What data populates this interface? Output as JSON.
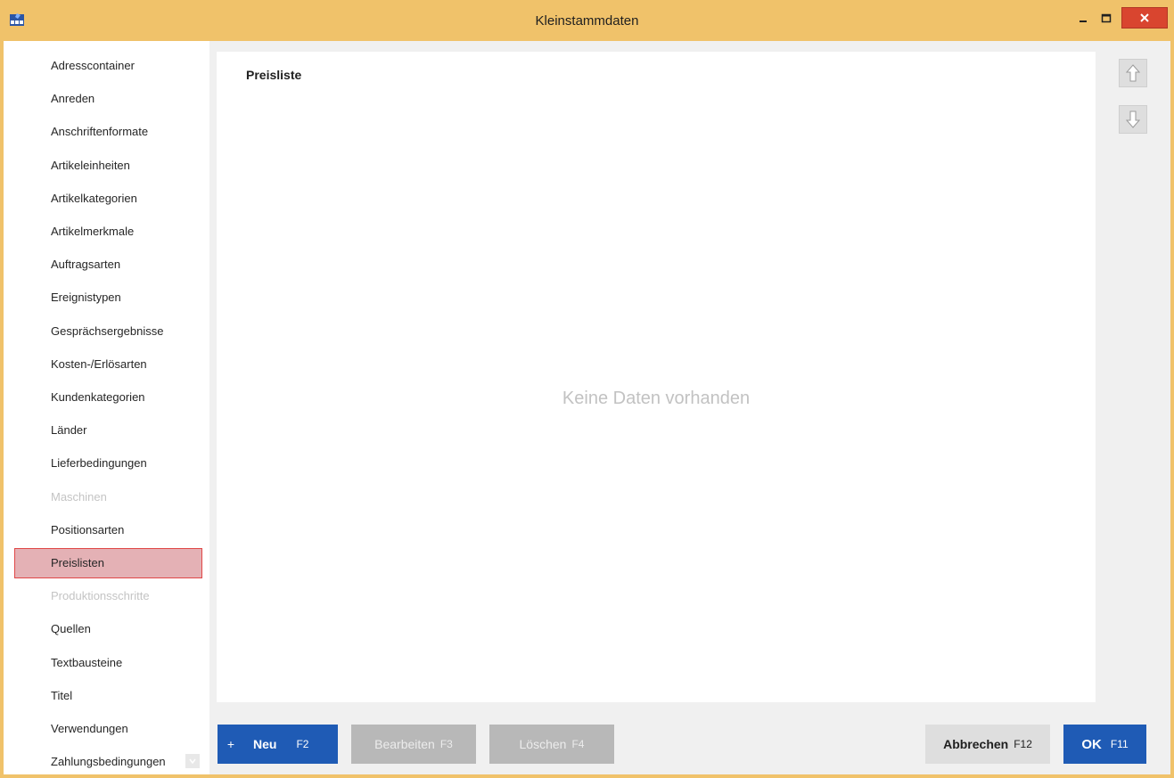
{
  "window": {
    "title": "Kleinstammdaten",
    "accent_color": "#f0c26a",
    "close_color": "#d9452f"
  },
  "icons": {
    "app": "app-icon",
    "minimize": "minimize-icon",
    "maximize": "maximize-icon",
    "close": "close-icon",
    "up": "arrow-up-icon",
    "down": "arrow-down-icon",
    "scroll": "chevron-down-icon"
  },
  "sidebar": {
    "items": [
      {
        "label": "Adresscontainer",
        "state": "normal"
      },
      {
        "label": "Anreden",
        "state": "normal"
      },
      {
        "label": "Anschriftenformate",
        "state": "normal"
      },
      {
        "label": "Artikeleinheiten",
        "state": "normal"
      },
      {
        "label": "Artikelkategorien",
        "state": "normal"
      },
      {
        "label": "Artikelmerkmale",
        "state": "normal"
      },
      {
        "label": "Auftragsarten",
        "state": "normal"
      },
      {
        "label": "Ereignistypen",
        "state": "normal"
      },
      {
        "label": "Gesprächsergebnisse",
        "state": "normal"
      },
      {
        "label": "Kosten-/Erlösarten",
        "state": "normal"
      },
      {
        "label": "Kundenkategorien",
        "state": "normal"
      },
      {
        "label": "Länder",
        "state": "normal"
      },
      {
        "label": "Lieferbedingungen",
        "state": "normal"
      },
      {
        "label": "Maschinen",
        "state": "disabled"
      },
      {
        "label": "Positionsarten",
        "state": "normal"
      },
      {
        "label": "Preislisten",
        "state": "selected"
      },
      {
        "label": "Produktionsschritte",
        "state": "disabled"
      },
      {
        "label": "Quellen",
        "state": "normal"
      },
      {
        "label": "Textbausteine",
        "state": "normal"
      },
      {
        "label": "Titel",
        "state": "normal"
      },
      {
        "label": "Verwendungen",
        "state": "normal"
      },
      {
        "label": "Zahlungsbedingungen",
        "state": "normal"
      }
    ],
    "selected_color": "#e4b1b5",
    "selected_border": "#e04747"
  },
  "panel": {
    "title": "Preisliste",
    "empty_message": "Keine Daten vorhanden"
  },
  "buttons": {
    "new": {
      "icon": "+",
      "label": "Neu",
      "key": "F2"
    },
    "edit": {
      "label": "Bearbeiten",
      "key": "F3"
    },
    "delete": {
      "label": "Löschen",
      "key": "F4"
    },
    "cancel": {
      "label": "Abbrechen",
      "key": "F12"
    },
    "ok": {
      "label": "OK",
      "key": "F11"
    },
    "primary_color": "#1f5bb5",
    "disabled_color": "#b8b8b8"
  }
}
